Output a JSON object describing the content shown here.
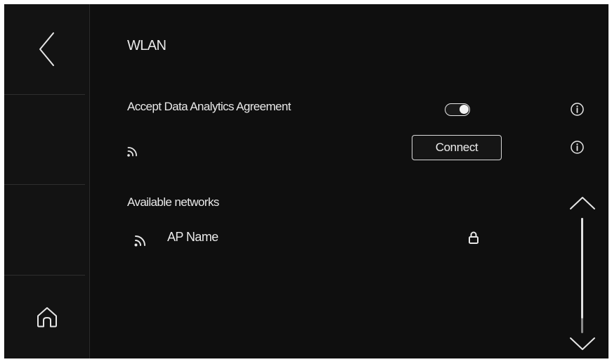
{
  "header": {
    "title": "WLAN"
  },
  "sidebar": {
    "back_icon": "chevron-left-icon",
    "home_icon": "home-icon"
  },
  "settings": {
    "agreement_label": "Accept Data Analytics Agreement",
    "agreement_enabled": true,
    "agreement_info_icon": "info-icon",
    "wifi_status_icon": "wifi-icon",
    "connect_label": "Connect",
    "connect_info_icon": "info-icon"
  },
  "networks": {
    "section_label": "Available networks",
    "items": [
      {
        "name": "AP Name",
        "icon": "wifi-icon",
        "secured": true
      }
    ]
  },
  "scroll": {
    "up_icon": "chevron-up-icon",
    "down_icon": "chevron-down-icon",
    "thumb_fraction": 0.87
  },
  "colors": {
    "background": "#0f0f0f",
    "sidebar": "#131313",
    "foreground": "#e9e9e9"
  }
}
